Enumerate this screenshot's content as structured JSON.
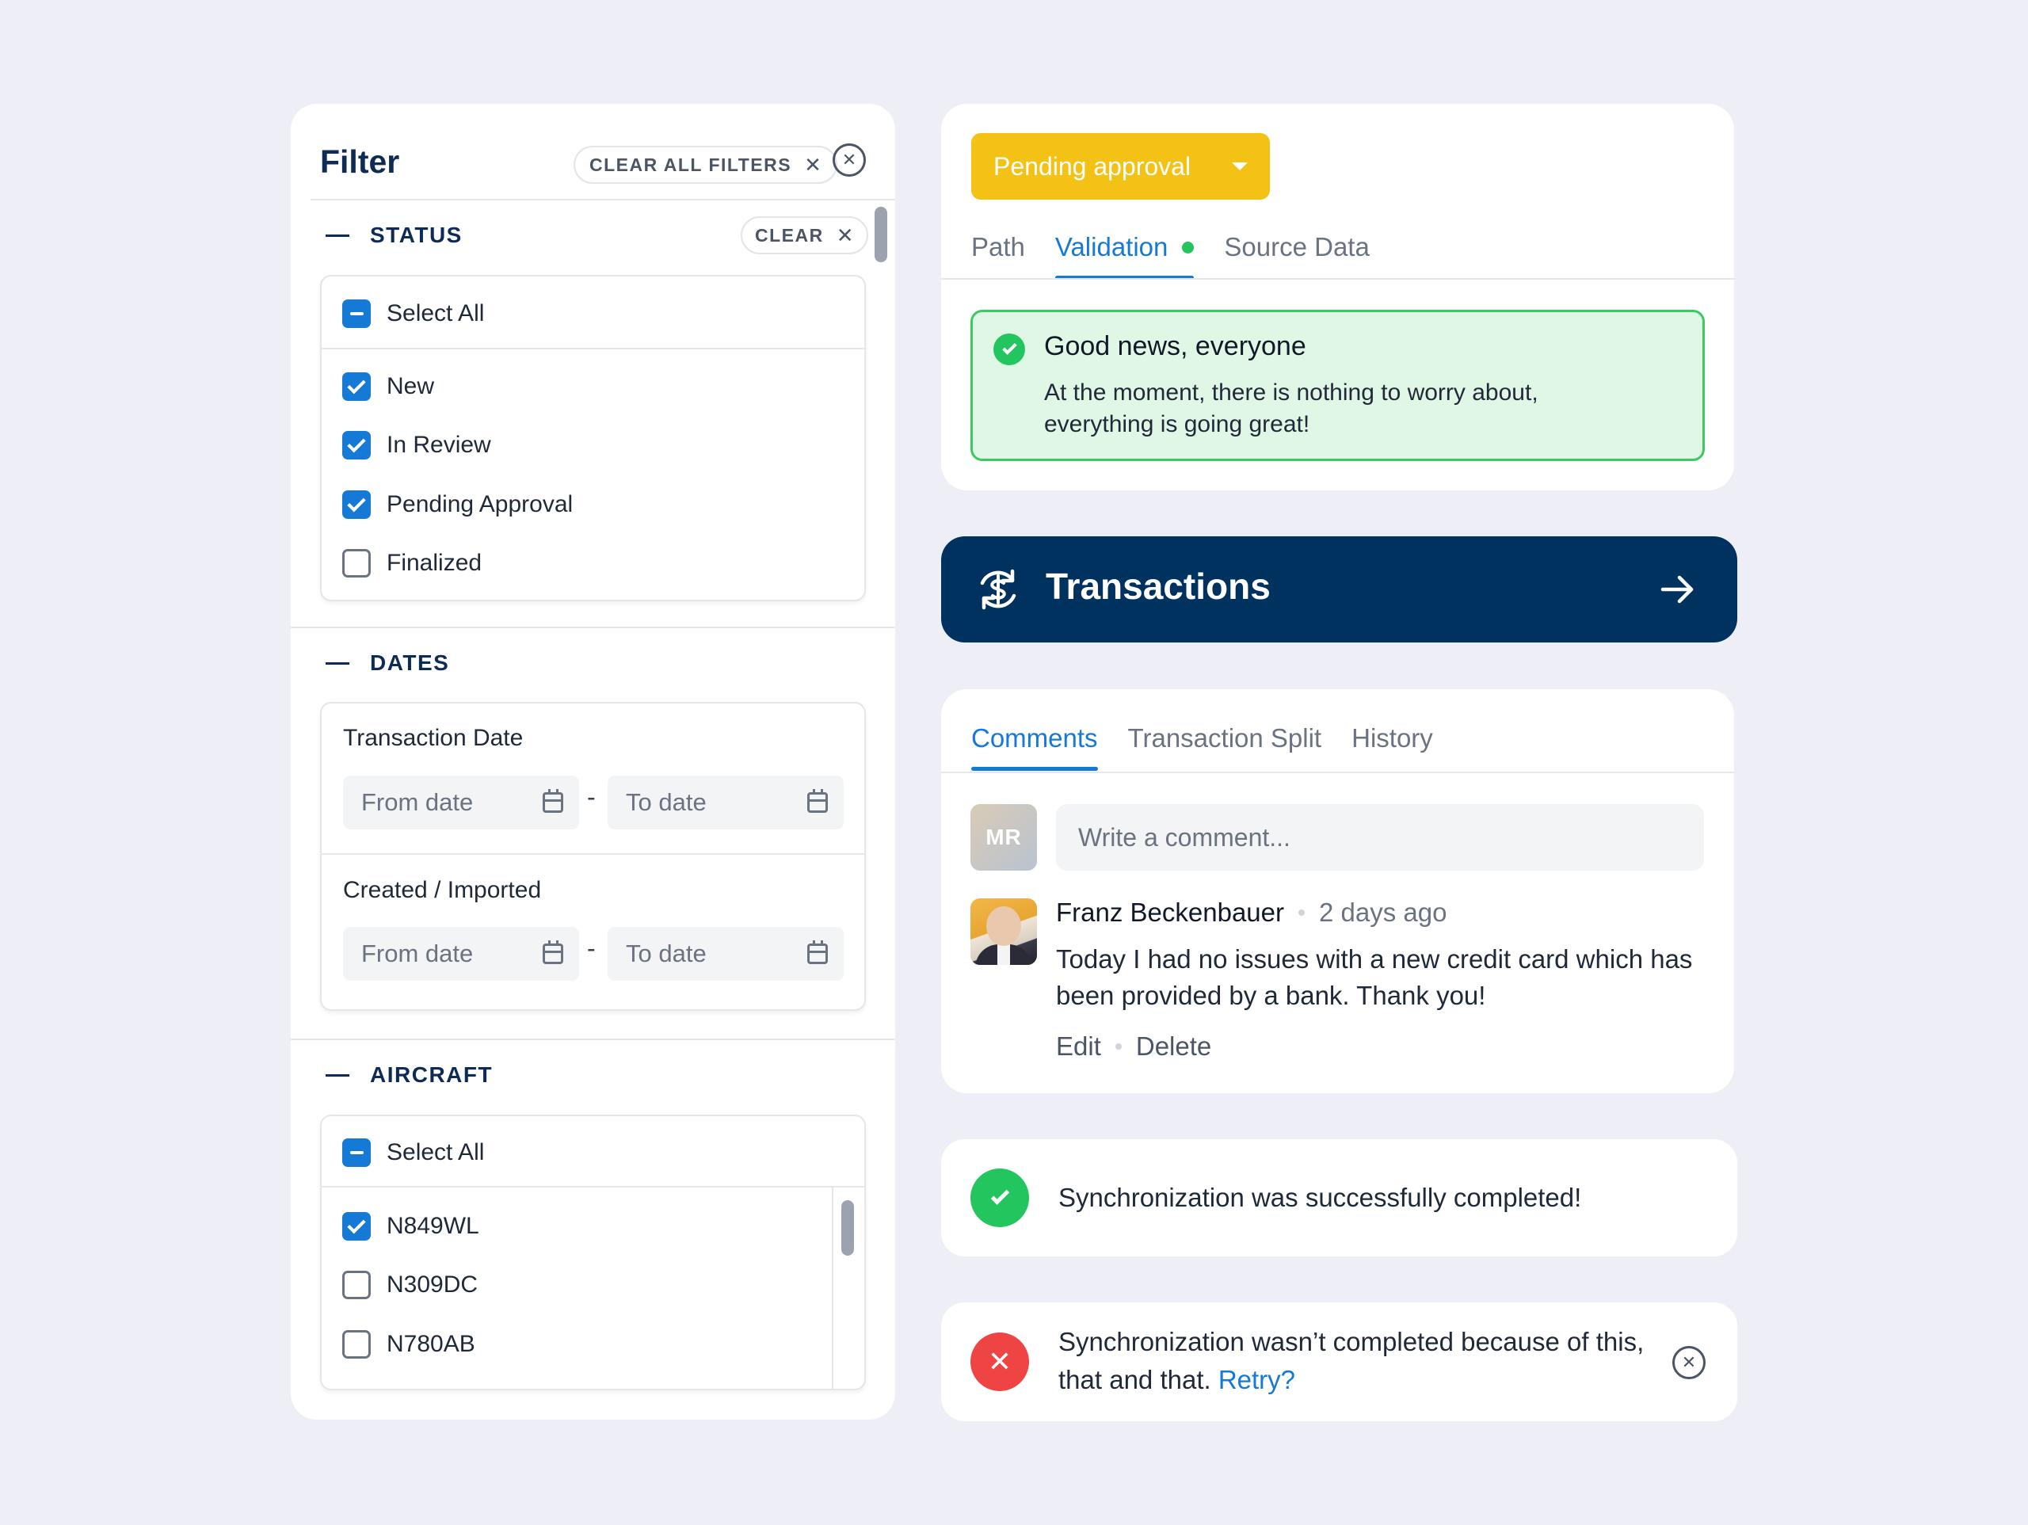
{
  "filter": {
    "title": "Filter",
    "clear_all_label": "CLEAR ALL FILTERS",
    "status": {
      "title": "STATUS",
      "clear_label": "CLEAR",
      "select_all": "Select All",
      "items": [
        {
          "label": "New",
          "checked": true
        },
        {
          "label": "In Review",
          "checked": true
        },
        {
          "label": "Pending Approval",
          "checked": true
        },
        {
          "label": "Finalized",
          "checked": false
        }
      ]
    },
    "dates": {
      "title": "DATES",
      "transaction_date": {
        "label": "Transaction Date",
        "from_placeholder": "From date",
        "to_placeholder": "To date"
      },
      "created_imported": {
        "label": "Created / Imported",
        "from_placeholder": "From date",
        "to_placeholder": "To date"
      },
      "separator": "-"
    },
    "aircraft": {
      "title": "AIRCRAFT",
      "select_all": "Select All",
      "items": [
        {
          "label": "N849WL",
          "checked": true
        },
        {
          "label": "N309DC",
          "checked": false
        },
        {
          "label": "N780AB",
          "checked": false
        }
      ]
    }
  },
  "validation": {
    "status_button": "Pending approval",
    "tabs": [
      {
        "label": "Path",
        "active": false
      },
      {
        "label": "Validation",
        "active": true
      },
      {
        "label": "Source Data",
        "active": false
      }
    ],
    "alert": {
      "title": "Good news, everyone",
      "body": "At the moment, there is nothing to worry about, everything is going great!"
    }
  },
  "transactions": {
    "label": "Transactions"
  },
  "comments": {
    "tabs": [
      {
        "label": "Comments",
        "active": true
      },
      {
        "label": "Transaction Split",
        "active": false
      },
      {
        "label": "History",
        "active": false
      }
    ],
    "current_user_initials": "MR",
    "input_placeholder": "Write a comment...",
    "entry": {
      "author": "Franz Beckenbauer",
      "time": "2 days ago",
      "text": "Today I had no issues with a new credit card which has been provided by a bank. Thank you!",
      "edit_label": "Edit",
      "delete_label": "Delete"
    }
  },
  "toasts": {
    "success": {
      "text": "Synchronization was successfully completed!"
    },
    "error": {
      "text": "Synchronization wasn’t completed because of this, that and that.",
      "retry_label": "Retry?"
    }
  },
  "colors": {
    "accent": "#1579d6",
    "navy": "#003260",
    "warning": "#f4c215",
    "success": "#22c55e",
    "danger": "#ef4444",
    "background": "#eeeff6"
  }
}
